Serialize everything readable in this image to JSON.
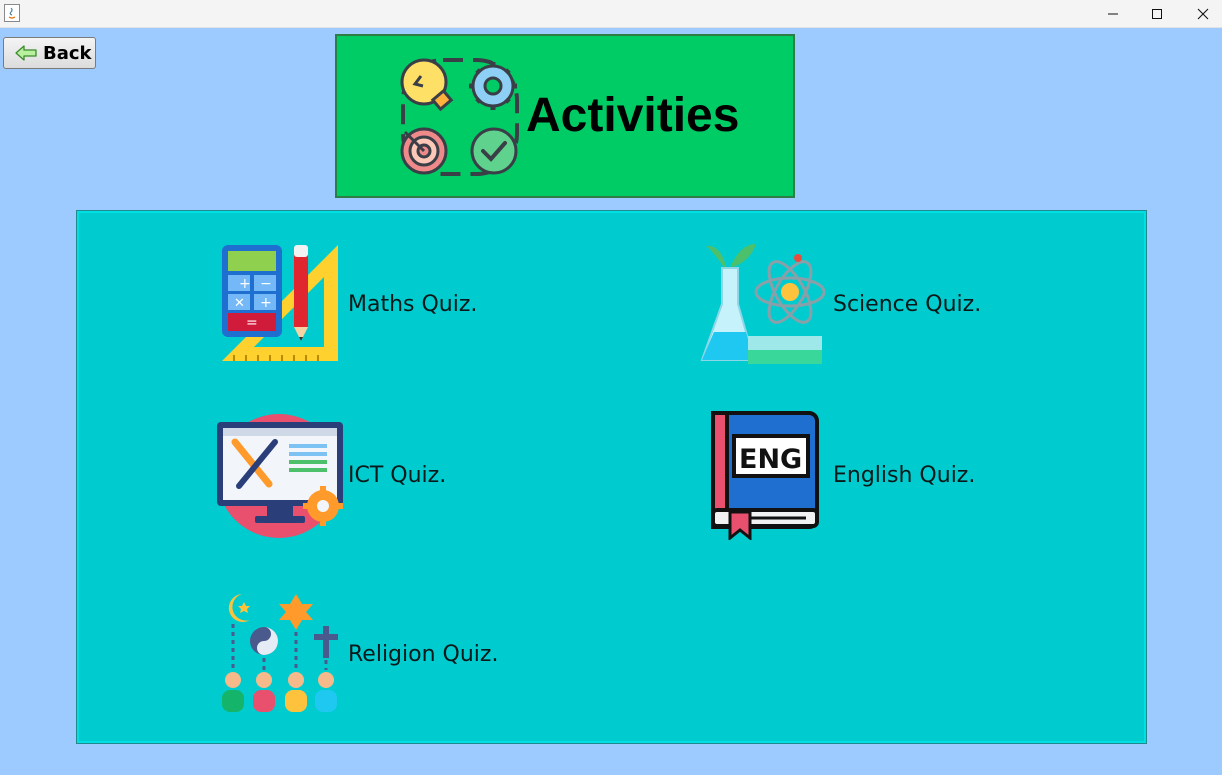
{
  "window": {
    "minimize_glyph": "—",
    "maximize_glyph": "☐",
    "close_glyph": "✕"
  },
  "back": {
    "label": "Back",
    "icon": "arrow-left-icon"
  },
  "header": {
    "title": "Activities",
    "icon": "activities-icon"
  },
  "quizzes": [
    {
      "label": "Maths Quiz.",
      "icon": "calculator-ruler-icon"
    },
    {
      "label": "Science Quiz.",
      "icon": "science-flask-atom-icon"
    },
    {
      "label": "ICT Quiz.",
      "icon": "computer-tools-icon"
    },
    {
      "label": "English Quiz.",
      "icon": "english-book-icon"
    },
    {
      "label": "Religion Quiz.",
      "icon": "religion-symbols-icon"
    }
  ],
  "colors": {
    "background": "#9ecbff",
    "header_panel": "#00cc66",
    "main_panel": "#00ccd0"
  }
}
